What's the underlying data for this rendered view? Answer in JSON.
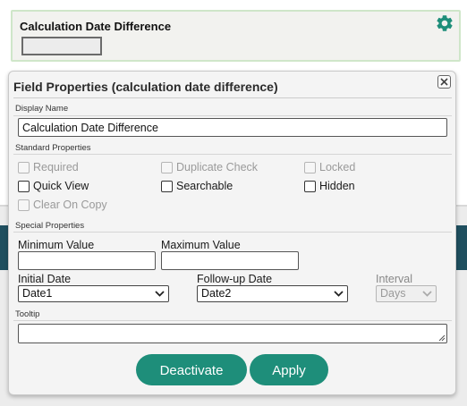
{
  "field_card": {
    "title": "Calculation Date Difference",
    "gear_icon": "gear-icon"
  },
  "dialog": {
    "title": "Field Properties (calculation date difference)",
    "close_icon": "close-icon",
    "display_name": {
      "label": "Display Name",
      "value": "Calculation Date Difference"
    },
    "standard_properties": {
      "label": "Standard Properties",
      "checkboxes": [
        {
          "label": "Required",
          "checked": false,
          "disabled": true
        },
        {
          "label": "Duplicate Check",
          "checked": false,
          "disabled": true
        },
        {
          "label": "Locked",
          "checked": false,
          "disabled": true
        },
        {
          "label": "Quick View",
          "checked": false,
          "disabled": false
        },
        {
          "label": "Searchable",
          "checked": false,
          "disabled": false
        },
        {
          "label": "Hidden",
          "checked": false,
          "disabled": false
        },
        {
          "label": "Clear On Copy",
          "checked": false,
          "disabled": true
        }
      ]
    },
    "special_properties": {
      "label": "Special Properties",
      "minimum_value": {
        "label": "Minimum Value",
        "value": ""
      },
      "maximum_value": {
        "label": "Maximum Value",
        "value": ""
      },
      "initial_date": {
        "label": "Initial Date",
        "selected": "Date1"
      },
      "followup_date": {
        "label": "Follow-up Date",
        "selected": "Date2"
      },
      "interval": {
        "label": "Interval",
        "selected": "Days",
        "disabled": true
      }
    },
    "tooltip": {
      "label": "Tooltip",
      "value": ""
    },
    "buttons": {
      "deactivate": "Deactivate",
      "apply": "Apply"
    }
  },
  "colors": {
    "accent_button": "#1e8e7a",
    "gear": "#1e8e7a",
    "card_border": "#cfe6c9"
  }
}
